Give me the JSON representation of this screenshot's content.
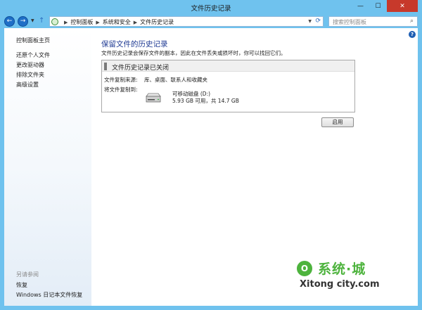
{
  "window": {
    "title": "文件历史记录",
    "minimize": "—",
    "maximize": "☐",
    "close": "✕"
  },
  "nav": {
    "back": "←",
    "forward": "→",
    "up": "↑",
    "breadcrumbs": [
      "控制面板",
      "系统和安全",
      "文件历史记录"
    ],
    "search_placeholder": "搜索控制面板"
  },
  "sidebar": {
    "home": "控制面板主页",
    "items": [
      "还原个人文件",
      "更改驱动器",
      "排除文件夹",
      "高级设置"
    ],
    "see_also_label": "另请参阅",
    "see_also": [
      "恢复",
      "Windows 日记本文件恢复"
    ]
  },
  "main": {
    "heading": "保留文件的历史记录",
    "description": "文件历史记录会保存文件的副本，因此在文件丢失或损坏时，你可以找回它们。",
    "status_title": "文件历史记录已关闭",
    "copy_from_label": "文件复制来源:",
    "copy_from_value": "库、桌面、联系人和收藏夹",
    "copy_to_label": "将文件复制到:",
    "drive_name": "可移动磁盘 (D:)",
    "drive_space": "5.93 GB 可用，共 14.7 GB",
    "enable_button": "启用"
  },
  "watermark": {
    "logo_text": "系统·城",
    "url": "Xitong city.com"
  },
  "colors": {
    "chrome": "#6fc2ee",
    "heading": "#1f3a93",
    "close": "#c7392b",
    "watermark": "#4db33d"
  }
}
